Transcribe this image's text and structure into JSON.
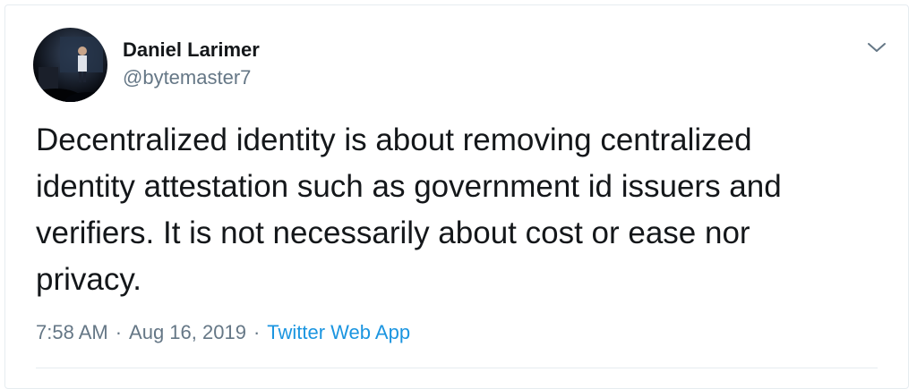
{
  "tweet": {
    "author": {
      "display_name": "Daniel Larimer",
      "handle": "@bytemaster7",
      "avatar_icon": "profile-photo"
    },
    "text": "Decentralized identity is about removing centralized\nidentity attestation such as government id issuers and\nverifiers.  It is not necessarily about cost or ease nor\nprivacy.",
    "time": "7:58 AM",
    "separator": "·",
    "date": "Aug 16, 2019",
    "source": "Twitter Web App",
    "menu_icon": "chevron-down-icon"
  },
  "colors": {
    "text_primary": "#14171a",
    "text_secondary": "#657786",
    "link": "#1b95e0",
    "border": "#e6ecf0"
  }
}
